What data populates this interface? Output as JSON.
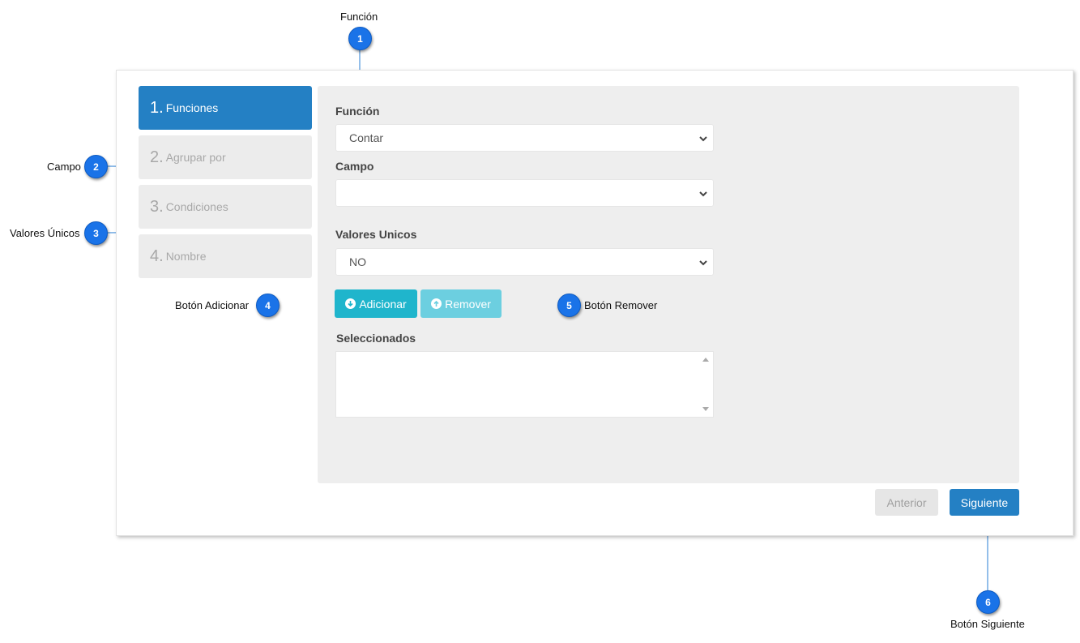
{
  "steps": [
    {
      "num": "1.",
      "label": "Funciones",
      "active": true
    },
    {
      "num": "2.",
      "label": "Agrupar por",
      "active": false
    },
    {
      "num": "3.",
      "label": "Condiciones",
      "active": false
    },
    {
      "num": "4.",
      "label": "Nombre",
      "active": false
    }
  ],
  "form": {
    "funcion": {
      "label": "Función",
      "value": "Contar"
    },
    "campo": {
      "label": "Campo",
      "value": ""
    },
    "valores_unicos": {
      "label": "Valores Unicos",
      "value": "NO"
    },
    "add_label": "Adicionar",
    "remove_label": "Remover",
    "seleccionados": {
      "label": "Seleccionados",
      "value": ""
    }
  },
  "nav": {
    "prev_label": "Anterior",
    "next_label": "Siguiente"
  },
  "callouts": [
    {
      "num": "1",
      "text": "Función"
    },
    {
      "num": "2",
      "text": "Campo"
    },
    {
      "num": "3",
      "text": "Valores Únicos"
    },
    {
      "num": "4",
      "text": "Botón  Adicionar"
    },
    {
      "num": "5",
      "text": "Botón  Remover"
    },
    {
      "num": "6",
      "text": "Botón Siguiente"
    }
  ],
  "colors": {
    "primary": "#2480c4",
    "info": "#1fb5cc",
    "info_light": "#6ccfe0",
    "callout": "#1a73e8"
  },
  "icons": {
    "add": "arrow-circle-down-icon",
    "remove": "arrow-circle-up-icon",
    "select": "chevron-down-icon"
  }
}
